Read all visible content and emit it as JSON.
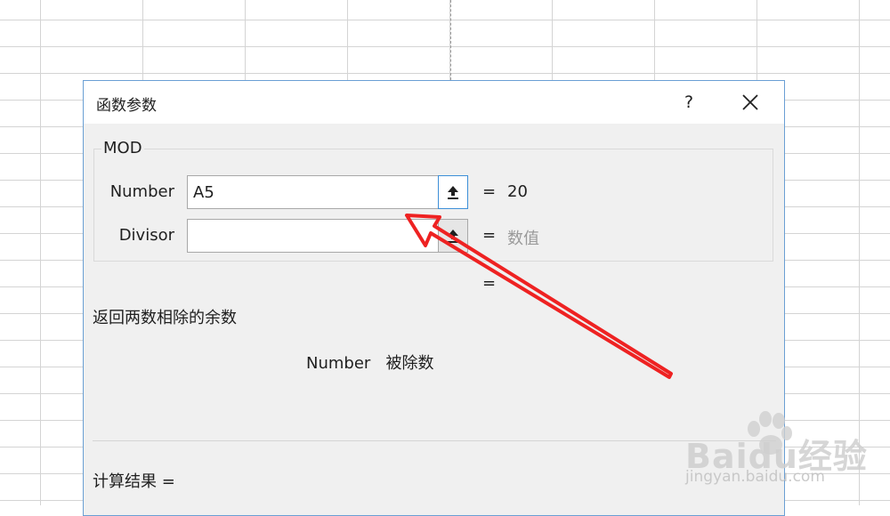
{
  "dialog": {
    "title": "函数参数",
    "help_label": "?",
    "function_name": "MOD",
    "args": [
      {
        "label": "Number",
        "value": "A5",
        "result": "20"
      },
      {
        "label": "Divisor",
        "value": "",
        "result": "数值"
      }
    ],
    "equals": "=",
    "description": "返回两数相除的余数",
    "arg_description": "Number   被除数",
    "calc_result": "计算结果 ="
  },
  "watermark": {
    "brand": "Baidu经验",
    "url": "jingyan.baidu.com"
  },
  "colors": {
    "annotation_arrow": "#ee2222",
    "dialog_border": "#6a9fd4",
    "focus_border": "#3d8fd8"
  },
  "icons": [
    "close-icon",
    "collapse-dialog-icon",
    "collapse-dialog-icon",
    "paw-icon"
  ]
}
